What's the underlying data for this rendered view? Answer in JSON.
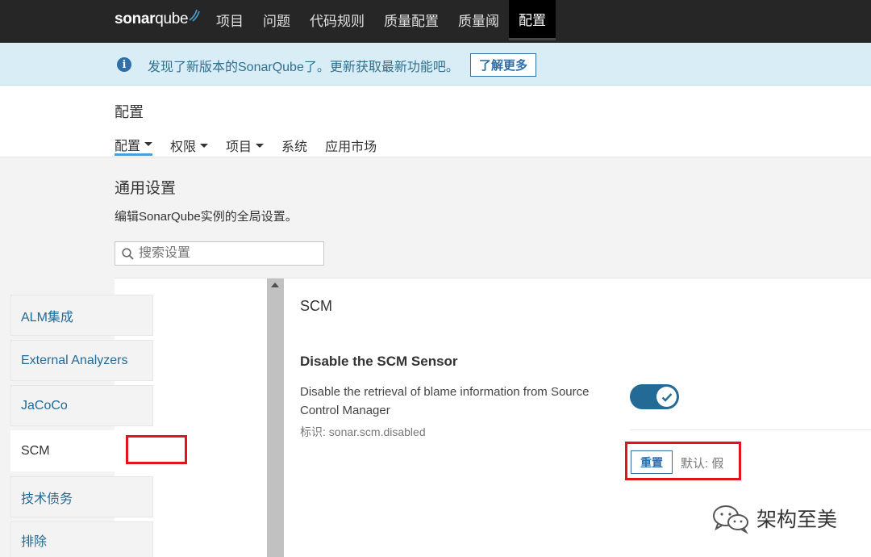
{
  "brand": {
    "logo_sonar": "sonar",
    "logo_qube": "qube"
  },
  "topnav": {
    "items": [
      {
        "label": "项目"
      },
      {
        "label": "问题"
      },
      {
        "label": "代码规则"
      },
      {
        "label": "质量配置"
      },
      {
        "label": "质量阈"
      },
      {
        "label": "配置",
        "active": true
      }
    ]
  },
  "banner": {
    "message": "发现了新版本的SonarQube了。更新获取最新功能吧。",
    "button_label": "了解更多"
  },
  "page": {
    "title": "配置",
    "subnav": [
      {
        "label": "配置",
        "dropdown": true,
        "active": true
      },
      {
        "label": "权限",
        "dropdown": true
      },
      {
        "label": "项目",
        "dropdown": true
      },
      {
        "label": "系统",
        "dropdown": false
      },
      {
        "label": "应用市场",
        "dropdown": false
      }
    ]
  },
  "settings": {
    "title": "通用设置",
    "description": "编辑SonarQube实例的全局设置。",
    "search_placeholder": "搜索设置",
    "categories": [
      "ALM集成",
      "External Analyzers",
      "JaCoCo",
      "SCM",
      "技术债务",
      "排除"
    ],
    "selected_category": "SCM"
  },
  "content": {
    "category_title": "SCM",
    "setting": {
      "name": "Disable the SCM Sensor",
      "description": "Disable the retrieval of blame information from Source Control Manager",
      "key": "标识: sonar.scm.disabled",
      "enabled": true,
      "reset_label": "重置",
      "default_label": "默认: 假"
    }
  },
  "watermark": {
    "text": "架构至美"
  },
  "colors": {
    "topbar": "#262626",
    "link": "#236a97",
    "highlight": "#e0141a",
    "banner_bg": "#d9edf7"
  }
}
